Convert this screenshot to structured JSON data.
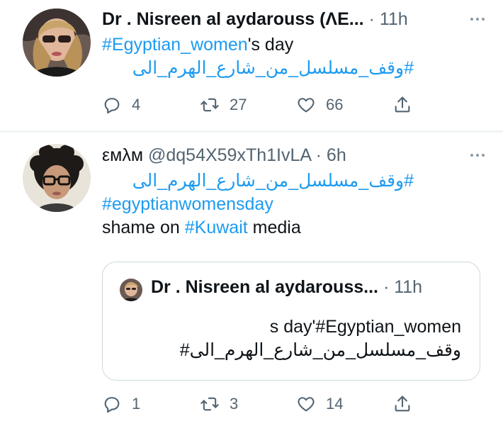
{
  "tweets": [
    {
      "name": "Dr . Nisreen al aydarouss (ΛΕ...",
      "time": "11h",
      "lines": [
        {
          "hashtag": "#Egyptian_women",
          "rest": "'s day"
        },
        {
          "hashtag": "#وقف_مسلسل_من_شارع_الهرم_الى"
        }
      ],
      "replies": "4",
      "retweets": "27",
      "likes": "66"
    },
    {
      "name": "εмλм",
      "handle": "@dq54X59xTh1IvLA",
      "time": "6h",
      "lines": [
        {
          "hashtag": "#وقف_مسلسل_من_شارع_الهرم_الى"
        },
        {
          "hashtag": "#egyptianwomensday"
        },
        {
          "before": "shame on ",
          "hashtag": "#Kuwait",
          "after": " media"
        }
      ],
      "quote": {
        "name": "Dr . Nisreen al aydarouss...",
        "time": "11h",
        "line1": "s day'#Egyptian_women",
        "line2": "#وقف_مسلسل_من_شارع_الهرم_الى"
      },
      "replies": "1",
      "retweets": "3",
      "likes": "14"
    }
  ],
  "separator": "·",
  "colors": {
    "link": "#1d9bf0",
    "muted": "#536471",
    "text": "#0f1419",
    "border": "#cfd9de"
  }
}
